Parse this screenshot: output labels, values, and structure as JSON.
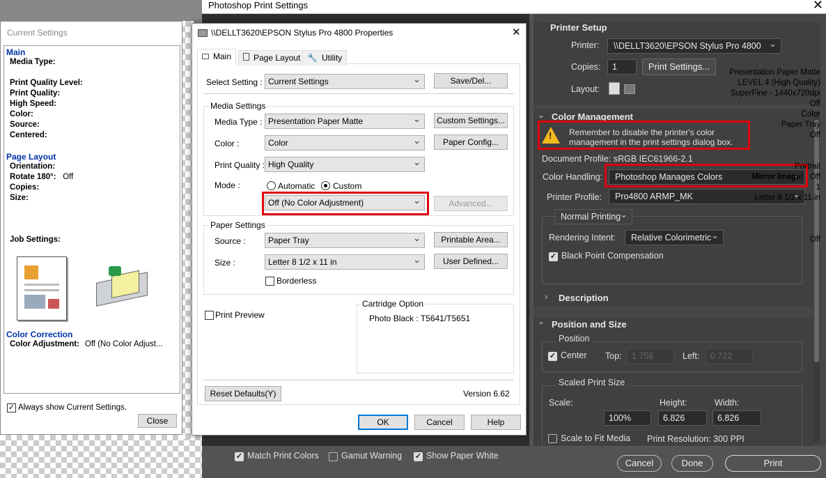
{
  "ps_title": "Photoshop Print Settings",
  "cs": {
    "title": "Current Settings",
    "main_head": "Main",
    "media_type_label": "Media Type:",
    "media_type_value": "Presentation Paper Matte",
    "pql_label": "Print Quality Level:",
    "pql_value": "LEVEL 4 (High Quality)",
    "pq_label": "Print Quality:",
    "pq_value": "SuperFine - 1440x720dpi",
    "hs_label": "High Speed:",
    "hs_value": "Off",
    "color_label": "Color:",
    "color_value": "Color",
    "source_label": "Source:",
    "source_value": "Paper Tray",
    "centered_label": "Centered:",
    "centered_value": "Off",
    "layout_head": "Page Layout",
    "orient_label": "Orientation:",
    "orient_value": "Portrait",
    "rotate_label": "Rotate 180°:",
    "rotate_value": "Off",
    "mirror_label": "Mirror Image:",
    "mirror_value": "Off",
    "copies_label": "Copies:",
    "copies_value": "1",
    "size_label": "Size:",
    "size_value": "Letter 8 1/2 x 11 in",
    "job_label": "Job Settings:",
    "job_value": "Off",
    "cc_head": "Color Correction",
    "ca_label": "Color Adjustment:",
    "ca_value": "Off (No Color Adjust...",
    "always_show": "Always show Current Settings.",
    "close": "Close"
  },
  "ep": {
    "title": "\\\\DELLT3620\\EPSON Stylus Pro 4800 Properties",
    "tabs": [
      "Main",
      "Page Layout",
      "Utility"
    ],
    "select_setting_label": "Select Setting :",
    "select_setting_value": "Current Settings",
    "save_del": "Save/Del...",
    "media_settings": "Media Settings",
    "media_type_label": "Media Type :",
    "media_type_value": "Presentation Paper Matte",
    "custom_settings": "Custom Settings...",
    "color_label": "Color :",
    "color_value": "Color",
    "paper_config": "Paper Config...",
    "pq_label": "Print Quality :",
    "pq_value": "High Quality",
    "mode_label": "Mode :",
    "automatic": "Automatic",
    "custom": "Custom",
    "mode_value": "Off (No Color Adjustment)",
    "advanced": "Advanced...",
    "paper_settings": "Paper Settings",
    "source_label": "Source :",
    "source_value": "Paper Tray",
    "printable_area": "Printable Area...",
    "size_label": "Size :",
    "size_value": "Letter 8 1/2 x 11 in",
    "user_defined": "User Defined...",
    "borderless": "Borderless",
    "print_preview": "Print Preview",
    "cartridge_option": "Cartridge Option",
    "cartridge_value": "Photo Black : T5641/T5651",
    "reset_defaults": "Reset Defaults(Y)",
    "version": "Version 6.62",
    "ok": "OK",
    "cancel": "Cancel",
    "help": "Help"
  },
  "ps": {
    "printer_setup": "Printer Setup",
    "printer_label": "Printer:",
    "printer_value": "\\\\DELLT3620\\EPSON Stylus Pro 4800",
    "copies_label": "Copies:",
    "copies_value": "1",
    "print_settings_btn": "Print Settings...",
    "layout_label": "Layout:",
    "color_management": "Color Management",
    "warning_text": "Remember to disable the printer's color management in the print settings dialog box.",
    "doc_profile": "Document Profile: sRGB IEC61966-2.1",
    "color_handling_label": "Color Handling:",
    "color_handling_value": "Photoshop Manages Colors",
    "printer_profile_label": "Printer Profile:",
    "printer_profile_value": "Pro4800 ARMP_MK",
    "normal_printing": "Normal Printing",
    "rendering_label": "Rendering Intent:",
    "rendering_value": "Relative Colorimetric",
    "bpc": "Black Point Compensation",
    "description": "Description",
    "position_size": "Position and Size",
    "position": "Position",
    "center": "Center",
    "top_label": "Top:",
    "top_value": "1.756",
    "left_label": "Left:",
    "left_value": "0.722",
    "scaled_print_size": "Scaled Print Size",
    "scale_label": "Scale:",
    "height_label": "Height:",
    "width_label": "Width:",
    "scale_value": "100%",
    "height_value": "6.826",
    "width_value": "6.826",
    "scale_to_fit": "Scale to Fit Media",
    "print_resolution": "Print Resolution: 300 PPI",
    "match_print_colors": "Match Print Colors",
    "gamut_warning": "Gamut Warning",
    "show_paper_white": "Show Paper White",
    "cancel": "Cancel",
    "done": "Done",
    "print": "Print"
  }
}
